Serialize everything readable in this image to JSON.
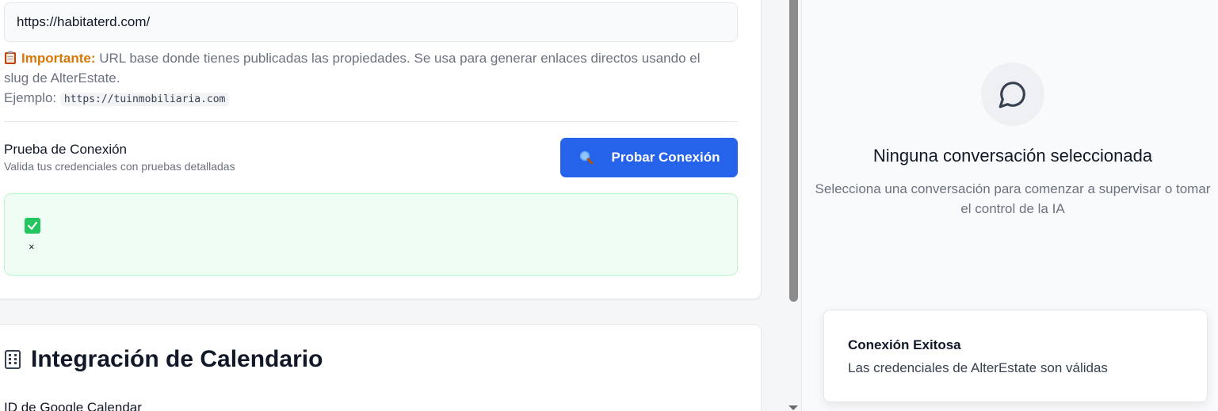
{
  "connection": {
    "base_url_value": "https://habitaterd.com/",
    "help_important": "Importante:",
    "help_text": "URL base donde tienes publicadas las propiedades. Se usa para generar enlaces directos usando el slug de AlterEstate.",
    "example_label": "Ejemplo:",
    "example_value": "https://tuinmobiliaria.com",
    "test_title": "Prueba de Conexión",
    "test_subtitle": "Valida tus credenciales con pruebas detalladas",
    "test_button": "Probar Conexión",
    "result_close": "×"
  },
  "calendar": {
    "heading": "Integración de Calendario",
    "google_id_label": "ID de Google Calendar"
  },
  "chat": {
    "empty_title": "Ninguna conversación seleccionada",
    "empty_subtitle": "Selecciona una conversación para comenzar a supervisar o tomar el control de la IA"
  },
  "toast": {
    "title": "Conexión Exitosa",
    "message": "Las credenciales de AlterEstate son válidas"
  },
  "icons": {
    "clipboard": "clipboard-icon",
    "magnifier": "search-icon",
    "check": "check-icon",
    "building": "building-icon",
    "chat": "chat-bubble-icon"
  },
  "colors": {
    "primary": "#2563eb",
    "success_bg": "#f0fdf4",
    "warning": "#d97706"
  }
}
